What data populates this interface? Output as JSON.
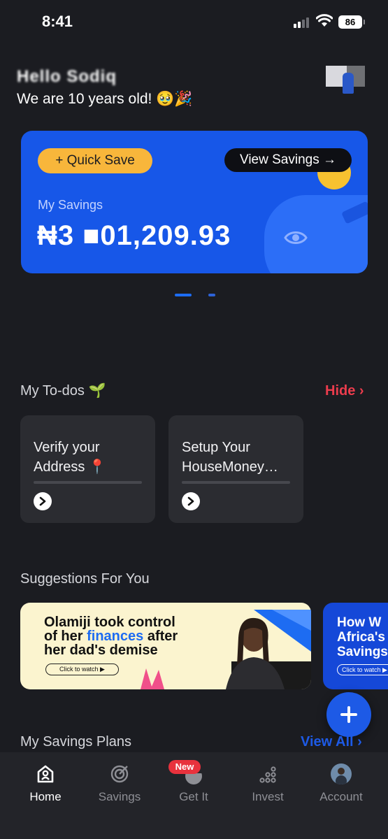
{
  "status_bar": {
    "time": "8:41",
    "battery": "86"
  },
  "header": {
    "greeting": "Hello Sodiq",
    "subtitle": "We are 10 years old! 🥹🎉"
  },
  "savings_card": {
    "quick_save_label": "+ Quick Save",
    "view_savings_label": "View Savings →",
    "balance_label": "My Savings",
    "balance_value": "₦3 ■01,209.93"
  },
  "carousel": {
    "pages": 2,
    "active": 1
  },
  "todos": {
    "title": "My To-dos 🌱",
    "hide_label": "Hide ›",
    "items": [
      {
        "line1": "Verify your",
        "line2": "Address 📍"
      },
      {
        "line1": "Setup Your",
        "line2": "HouseMoney…"
      }
    ]
  },
  "suggestions": {
    "title": "Suggestions For You",
    "banners": [
      {
        "line1": "Olamiji took control",
        "line2_pre": "of her ",
        "line2_hl": "finances",
        "line2_post": " after",
        "line3": "her dad's demise",
        "button": "Click to watch ▶"
      },
      {
        "line1": "How W",
        "line2": "Africa's",
        "line3": "Savings",
        "button": "Click to watch ▶"
      }
    ]
  },
  "plans": {
    "title": "My Savings Plans",
    "view_all": "View All ›"
  },
  "bottom_nav": {
    "items": [
      {
        "label": "Home",
        "icon": "home-icon",
        "active": true
      },
      {
        "label": "Savings",
        "icon": "target-icon",
        "active": false
      },
      {
        "label": "Get It",
        "icon": "gift-icon",
        "active": false,
        "badge": "New"
      },
      {
        "label": "Invest",
        "icon": "invest-icon",
        "active": false
      },
      {
        "label": "Account",
        "icon": "avatar-icon",
        "active": false
      }
    ]
  },
  "colors": {
    "background": "#1b1c21",
    "card_blue": "#1757e8",
    "quick_save": "#f8b63b",
    "accent_red": "#ec3c4d",
    "accent_blue": "#1d5ae6"
  }
}
